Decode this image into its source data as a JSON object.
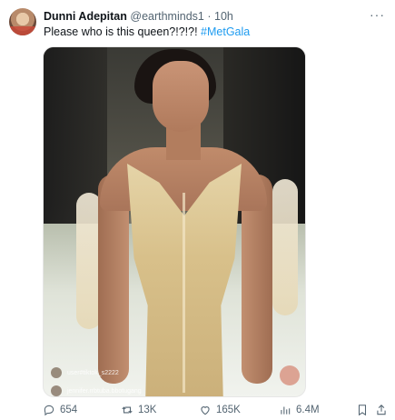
{
  "tweet": {
    "author_name": "Dunni Adepitan",
    "handle": "@earthminds1",
    "separator": "·",
    "time": "10h",
    "text": "Please who is this queen?!?!?!",
    "hashtag": "#MetGala",
    "more_label": "···"
  },
  "media": {
    "overlay_comments": [
      "user#tiktok_s2222",
      "jennifer.rrbtuba.bbotugang"
    ]
  },
  "actions": {
    "replies": "654",
    "retweets": "13K",
    "likes": "165K",
    "views": "6.4M"
  },
  "icons": {
    "reply": "reply-icon",
    "retweet": "retweet-icon",
    "like": "heart-icon",
    "views": "views-chart-icon",
    "bookmark": "bookmark-icon",
    "share": "share-icon",
    "more": "more-icon"
  },
  "colors": {
    "text": "#0f1419",
    "muted": "#536471",
    "link": "#1d9bf0"
  }
}
